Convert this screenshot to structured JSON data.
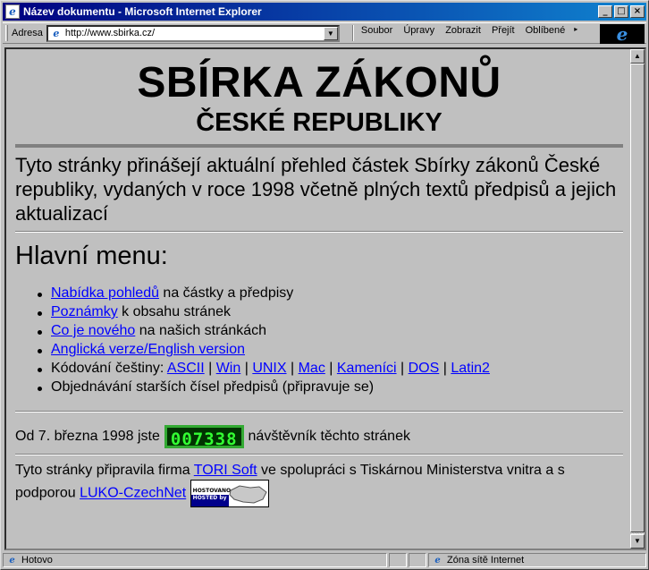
{
  "window": {
    "title": "Název dokumentu - Microsoft Internet Explorer"
  },
  "toolbar": {
    "address_label": "Adresa",
    "url": "http://www.sbirka.cz/",
    "menus": [
      "Soubor",
      "Úpravy",
      "Zobrazit",
      "Přejít",
      "Oblíbené"
    ]
  },
  "page": {
    "title": "SBÍRKA ZÁKONŮ",
    "subtitle": "ČESKÉ REPUBLIKY",
    "intro": "Tyto stránky přinášejí aktuální přehled částek Sbírky zákonů České republiky, vydaných v roce 1998 včetně plných textů předpisů a jejich aktualizací",
    "menu_heading": "Hlavní menu:",
    "items": [
      {
        "link": "Nabídka pohledů",
        "rest": " na částky a předpisy"
      },
      {
        "link": "Poznámky",
        "rest": " k obsahu stránek"
      },
      {
        "link": "Co je nového",
        "rest": " na našich stránkách"
      },
      {
        "link": "Anglická verze/English version",
        "rest": ""
      }
    ],
    "encoding_label": "Kódování češtiny: ",
    "encodings": [
      "ASCII",
      "Win",
      "UNIX",
      "Mac",
      "Kameníci",
      "DOS",
      "Latin2"
    ],
    "encoding_sep": " | ",
    "orders_text": "Objednávání starších čísel předpisů (připravuje se)",
    "counter_prefix": "Od 7. března 1998 jste ",
    "counter_value": "007338",
    "counter_suffix": " návštěvník těchto stránek",
    "footer_prefix": "Tyto stránky připravila firma ",
    "footer_link1": "TORI Soft",
    "footer_middle": " ve spolupráci s Tiskárnou Ministerstva vnitra a s podporou ",
    "footer_link2": "LUKO-CzechNet",
    "badge_top": "HOSTOVANO na",
    "badge_bottom": "HOSTED by"
  },
  "status": {
    "left": "Hotovo",
    "zone": "Zóna sítě Internet"
  },
  "colors": {
    "link": "#0000ff",
    "titlebar_start": "#000080",
    "titlebar_end": "#1084d0",
    "counter_digits": "#33ff33"
  },
  "icons": [
    "ie-page-icon",
    "minimize-icon",
    "maximize-icon",
    "close-icon",
    "dropdown-arrow-icon",
    "ie-logo-icon",
    "scroll-up-icon",
    "scroll-down-icon",
    "internet-zone-icon"
  ]
}
